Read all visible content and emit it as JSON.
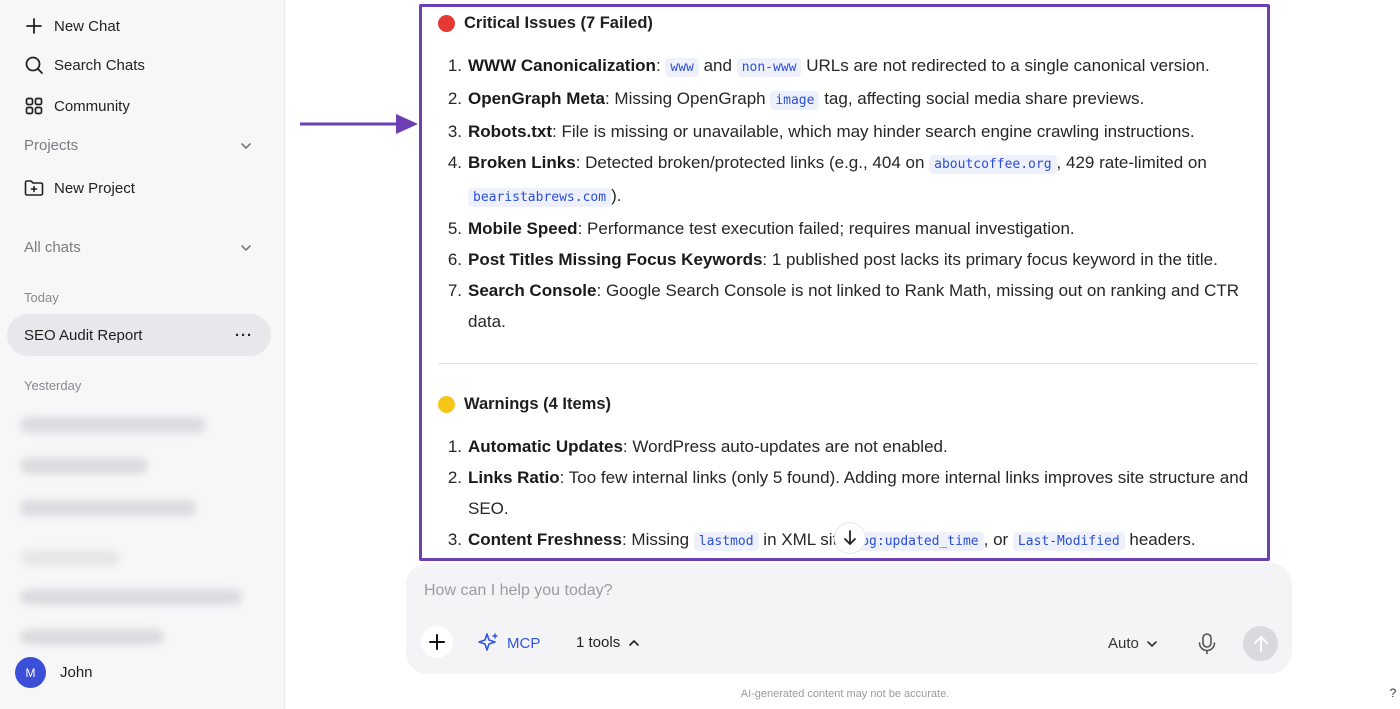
{
  "sidebar": {
    "new_chat": "New Chat",
    "search_chats": "Search Chats",
    "community": "Community",
    "projects": "Projects",
    "new_project": "New Project",
    "all_chats": "All chats",
    "today": "Today",
    "active_chat": "SEO Audit Report",
    "active_chat_menu": "···",
    "yesterday": "Yesterday",
    "user_initial": "M",
    "user_name": "John"
  },
  "report": {
    "critical_heading": "Critical Issues (7 Failed)",
    "critical_items": [
      {
        "num": "1.",
        "title": "WWW Canonicalization",
        "parts": [
          ": ",
          "www",
          " and ",
          "non-www",
          " URLs are not redirected to a single canonical version."
        ]
      },
      {
        "num": "2.",
        "title": "OpenGraph Meta",
        "parts": [
          ": Missing OpenGraph ",
          "image",
          " tag, affecting social media share previews."
        ]
      },
      {
        "num": "3.",
        "title": "Robots.txt",
        "parts": [
          ": File is missing or unavailable, which may hinder search engine crawling instructions."
        ]
      },
      {
        "num": "4.",
        "title": "Broken Links",
        "parts": [
          ": Detected broken/protected links (e.g., 404 on ",
          "aboutcoffee.org",
          ", 429 rate-limited on ",
          "bearistabrews.com",
          ")."
        ]
      },
      {
        "num": "5.",
        "title": "Mobile Speed",
        "parts": [
          ": Performance test execution failed; requires manual investigation."
        ]
      },
      {
        "num": "6.",
        "title": "Post Titles Missing Focus Keywords",
        "parts": [
          ": 1 published post lacks its primary focus keyword in the title."
        ]
      },
      {
        "num": "7.",
        "title": "Search Console",
        "parts": [
          ": Google Search Console is not linked to Rank Math, missing out on ranking and CTR data."
        ]
      }
    ],
    "warnings_heading": "Warnings (4 Items)",
    "warning_items": [
      {
        "num": "1.",
        "title": "Automatic Updates",
        "parts": [
          ": WordPress auto-updates are not enabled."
        ]
      },
      {
        "num": "2.",
        "title": "Links Ratio",
        "parts": [
          ": Too few internal links (only 5 found). Adding more internal links improves site structure and SEO."
        ]
      },
      {
        "num": "3.",
        "title": "Content Freshness",
        "parts": [
          ": Missing ",
          "lastmod",
          " in XML sit",
          "p, ",
          "og:updated_time",
          ", or ",
          "Last-Modified",
          " headers."
        ]
      }
    ]
  },
  "composer": {
    "placeholder": "How can I help you today?",
    "mcp_label": "MCP",
    "tools_label": "1 tools",
    "model_label": "Auto"
  },
  "disclaimer": "AI-generated content may not be accurate.",
  "help_label": "?",
  "colors": {
    "accent_frame": "#6c3fb5",
    "critical_dot": "#e53935",
    "warning_dot": "#f5c518",
    "code_text": "#2a4fd6",
    "avatar_bg": "#3b4fd8"
  }
}
